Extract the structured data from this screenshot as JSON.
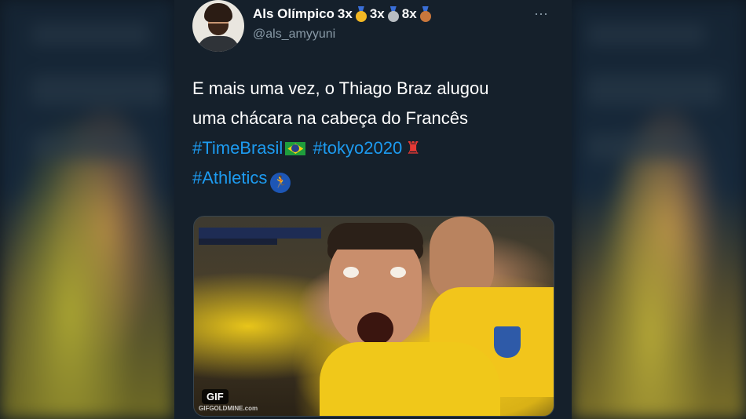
{
  "tweet": {
    "display_name": "Als Olímpico",
    "medals": [
      {
        "count": "3x",
        "type": "gold-medal-icon"
      },
      {
        "count": "3x",
        "type": "silver-medal-icon"
      },
      {
        "count": "8x",
        "type": "bronze-medal-icon"
      }
    ],
    "handle": "@als_amyyuni",
    "more_icon": "⋯",
    "text_lines": [
      "E mais uma vez, o Thiago Braz alugou",
      "uma chácara na cabeça do Francês"
    ],
    "hashtags": [
      "#TimeBrasil",
      "#tokyo2020",
      "#Athletics"
    ],
    "media": {
      "badge": "GIF",
      "watermark": "GIFGOLDMINE.com"
    }
  },
  "colors": {
    "card_bg": "#15202b",
    "hashtag": "#1d9bf0",
    "handle": "#8899a6"
  }
}
